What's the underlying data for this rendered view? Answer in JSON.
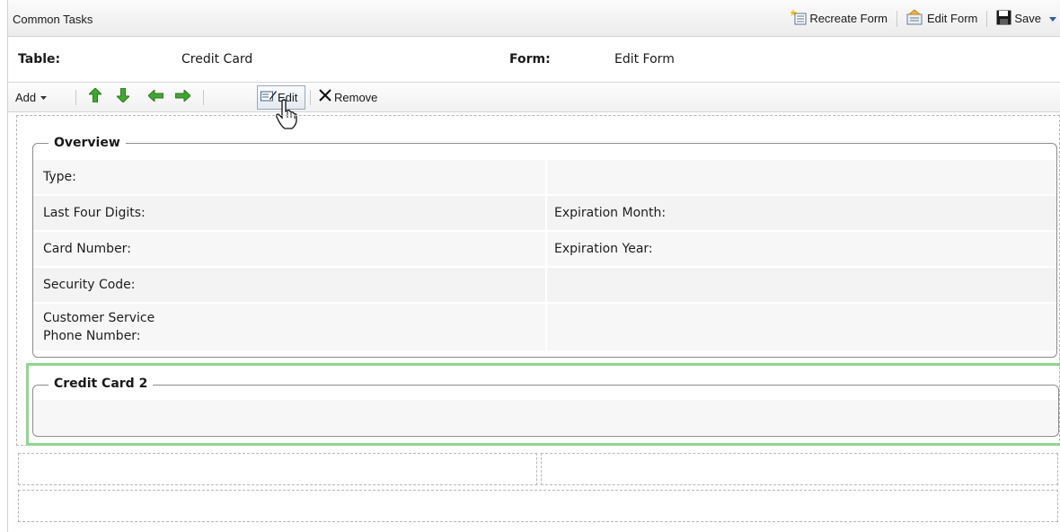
{
  "tasks_bar": {
    "title": "Common Tasks",
    "recreate_form": "Recreate Form",
    "edit_form": "Edit Form",
    "save": "Save"
  },
  "info": {
    "table_label": "Table:",
    "table_value": "Credit Card",
    "form_label": "Form:",
    "form_value": "Edit Form"
  },
  "toolbar": {
    "add": "Add",
    "edit": "Edit",
    "remove": "Remove"
  },
  "overview": {
    "legend": "Overview",
    "rows": [
      {
        "left": "Type:",
        "right": ""
      },
      {
        "left": "Last Four Digits:",
        "right": "Expiration Month:"
      },
      {
        "left": "Card Number:",
        "right": "Expiration Year:"
      },
      {
        "left": "Security Code:",
        "right": ""
      },
      {
        "left_line1": "Customer Service",
        "left_line2": "Phone Number:",
        "right": ""
      }
    ]
  },
  "credit_card_2": {
    "legend": "Credit Card 2"
  },
  "colors": {
    "selection_border": "#8fd68f",
    "arrow_green": "#3fa82e",
    "save_blue": "#1f4fa8"
  }
}
